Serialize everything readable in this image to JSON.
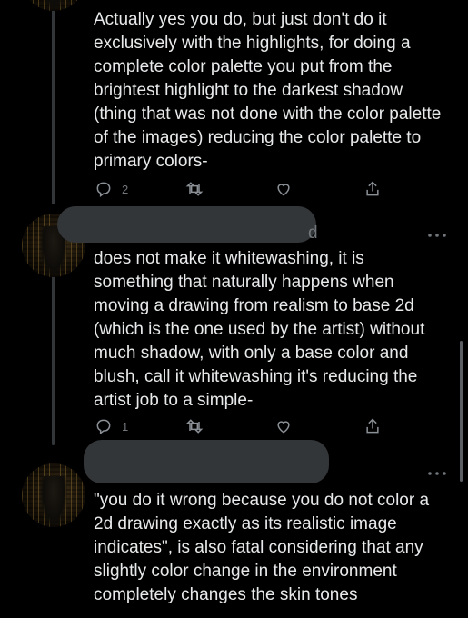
{
  "tweets": [
    {
      "text": "Actually yes you do, but just don't do it exclusively with the highlights, for doing a complete color palette you put from the brightest highlight to the darkest shadow (thing that was not done with the color palette of the images) reducing the color palette to primary colors-",
      "reply_count": "2",
      "retweet_count": "",
      "like_count": ""
    },
    {
      "handle_tail": "d",
      "text": "does not make it whitewashing, it is something that naturally happens when moving a drawing from realism to base 2d (which is the one used by the artist) without much shadow, with only a base color and blush, call it whitewashing it's reducing the artist job to a simple-",
      "reply_count": "1",
      "retweet_count": "",
      "like_count": ""
    },
    {
      "text": "\"you do it wrong because you do not color a 2d drawing exactly as its realistic image indicates\", is also fatal considering that any slightly color change in the environment completely changes the skin tones"
    }
  ],
  "colors": {
    "background": "#000000",
    "text": "#e7e9ea",
    "muted": "#71767b",
    "redaction": "#333639"
  },
  "icons": [
    "reply-icon",
    "retweet-icon",
    "like-icon",
    "share-icon",
    "more-icon"
  ]
}
